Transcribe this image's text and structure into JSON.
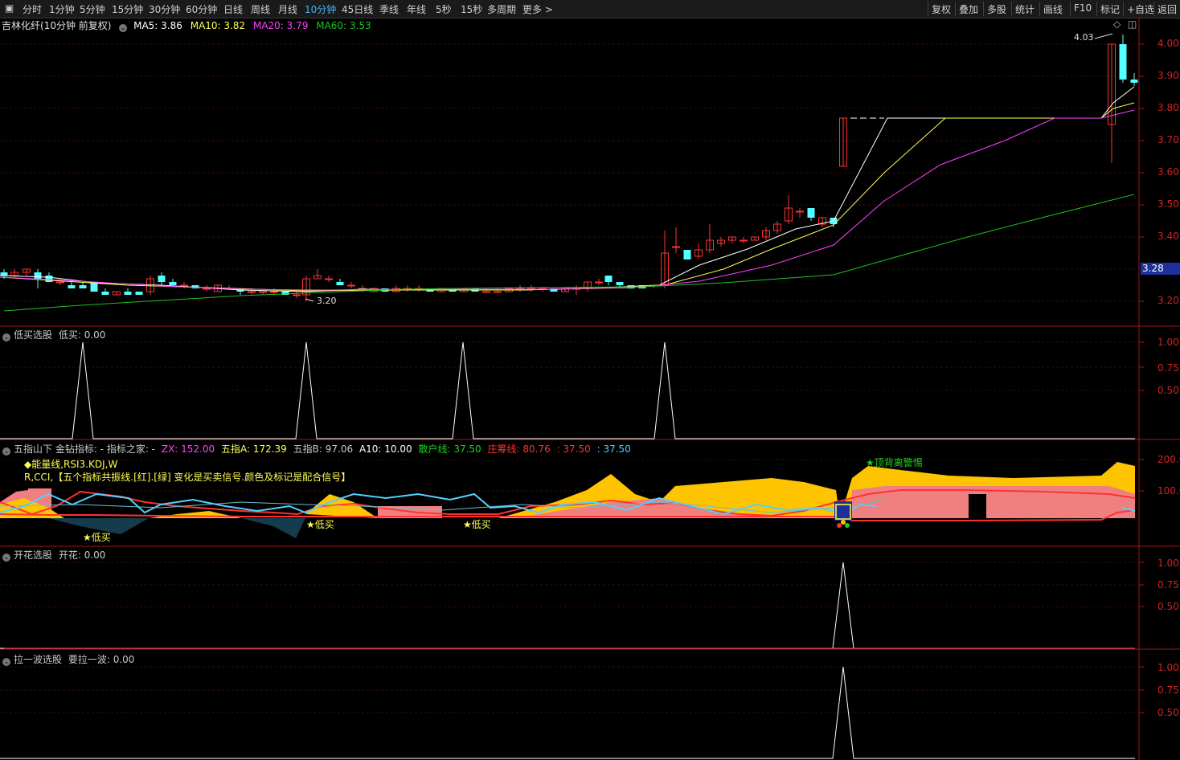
{
  "toolbar": {
    "left_icon": "layout-icon",
    "periods": [
      "分时",
      "1分钟",
      "5分钟",
      "15分钟",
      "30分钟",
      "60分钟",
      "日线",
      "周线",
      "月线",
      "10分钟",
      "45日线",
      "季线",
      "年线",
      "5秒",
      "15秒",
      "多周期",
      "更多 >"
    ],
    "active_period": "10分钟",
    "right_buttons": [
      "复权",
      "叠加",
      "多股",
      "统计",
      "画线",
      "F10",
      "标记",
      "+自选",
      "返回"
    ]
  },
  "main_chart": {
    "stock_name": "吉林化纤(10分钟 前复权)",
    "ma5": "MA5: 3.86",
    "ma10": "MA10: 3.82",
    "ma20": "MA20: 3.79",
    "ma60": "MA60: 3.53",
    "price_axis": [
      "4.00",
      "3.90",
      "3.80",
      "3.70",
      "3.60",
      "3.50",
      "3.40",
      "3.28",
      "3.20"
    ],
    "current_price": "3.28",
    "high_label": "4.03",
    "low_label": "3.20",
    "colors": {
      "up": "#ff3232",
      "down": "#54ffff",
      "ma5": "#ffffff",
      "ma10": "#ffff54",
      "ma20": "#ff40ff",
      "ma60": "#20c020"
    }
  },
  "panel_dimai": {
    "title": "低买选股",
    "value": "低买: 0.00",
    "axis": [
      "1.00",
      "0.75",
      "0.50"
    ]
  },
  "panel_wuzhi": {
    "title": "五指山下 金钻指标: - 指标之家: -",
    "zx": "ZX: 152.00",
    "a": "五指A: 172.39",
    "b": "五指B: 97.06",
    "a10": "A10: 10.00",
    "sanhu": "散户线: 37.50",
    "zhuang": "庄筹线: 80.76",
    "v1": ": 37.50",
    "v2": ": 37.50",
    "line1": "◆能量线,RSI3.KDJ,W",
    "line2": "R,CCI,【五个指标共振线.[红].[绿] 变化是买卖信号.颜色及标记是配合信号】",
    "axis": [
      "200.0",
      "100.0"
    ],
    "signal_top": "★顶背离警惕",
    "signal_low": "★低买"
  },
  "panel_kaihua": {
    "title": "开花选股",
    "value": "开花: 0.00",
    "axis": [
      "1.00",
      "0.75",
      "0.50"
    ]
  },
  "panel_layibo": {
    "title": "拉一波选股",
    "value": "要拉一波: 0.00",
    "axis": [
      "1.00",
      "0.75",
      "0.50"
    ]
  }
}
